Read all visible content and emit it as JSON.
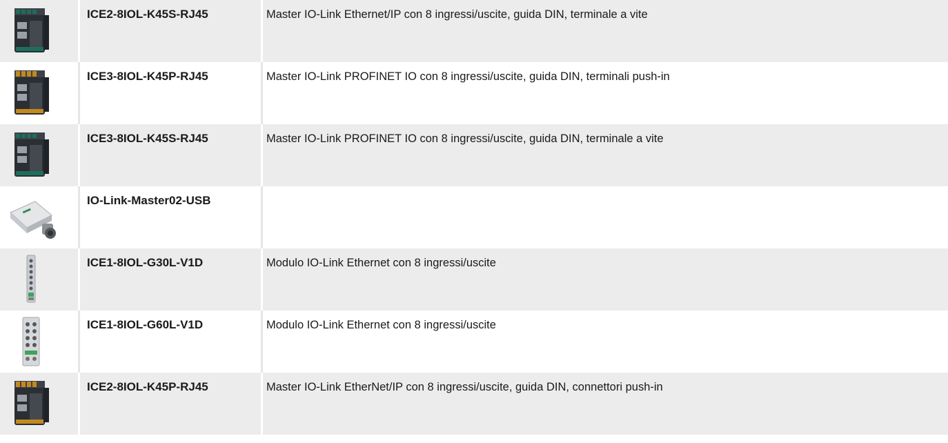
{
  "products": [
    {
      "code": "ICE2-8IOL-K45S-RJ45",
      "description": "Master IO-Link Ethernet/IP con 8 ingressi/uscite, guida DIN, terminale a vite",
      "icon": "din-rail-module-image"
    },
    {
      "code": "ICE3-8IOL-K45P-RJ45",
      "description": "Master IO-Link PROFINET IO con 8 ingressi/uscite, guida DIN, terminali push-in",
      "icon": "din-rail-module-image"
    },
    {
      "code": "ICE3-8IOL-K45S-RJ45",
      "description": "Master IO-Link PROFINET IO con 8 ingressi/uscite, guida DIN, terminale a vite",
      "icon": "din-rail-module-image"
    },
    {
      "code": "IO-Link-Master02-USB",
      "description": "",
      "icon": "usb-master-image"
    },
    {
      "code": "ICE1-8IOL-G30L-V1D",
      "description": "Modulo IO-Link Ethernet con 8 ingressi/uscite",
      "icon": "slim-field-module-image"
    },
    {
      "code": "ICE1-8IOL-G60L-V1D",
      "description": "Modulo IO-Link Ethernet con 8 ingressi/uscite",
      "icon": "wide-field-module-image"
    },
    {
      "code": "ICE2-8IOL-K45P-RJ45",
      "description": "Master IO-Link EtherNet/IP con 8 ingressi/uscite, guida DIN, connettori push-in",
      "icon": "din-rail-module-image"
    }
  ]
}
